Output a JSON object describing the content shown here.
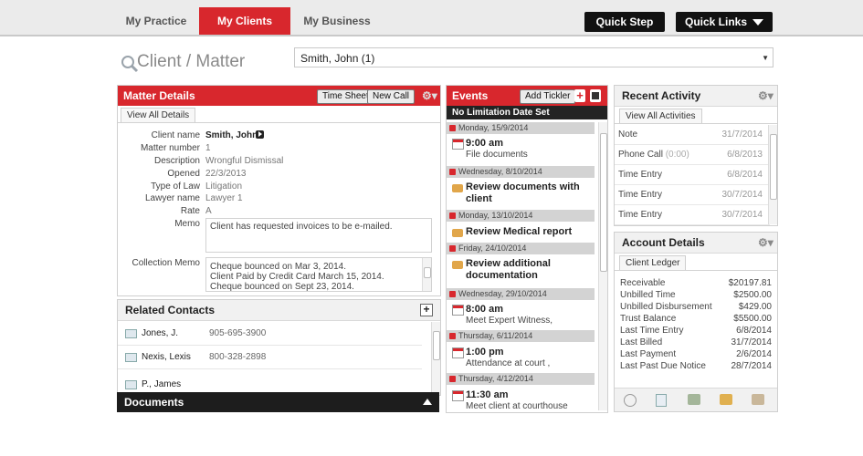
{
  "nav": {
    "tabs": [
      {
        "label": "My Practice"
      },
      {
        "label": "My Clients"
      },
      {
        "label": "My Business"
      }
    ],
    "quick_step": "Quick Step",
    "quick_links": "Quick Links",
    "accent": "#d8272d"
  },
  "search": {
    "title": "Client / Matter",
    "value": "Smith, John (1)"
  },
  "matter": {
    "header": "Matter Details",
    "time_sheet": "Time Sheet",
    "new_call": "New Call",
    "view_all": "View All Details",
    "fields": {
      "client_name_label": "Client name",
      "client_name": "Smith, John",
      "matter_number_label": "Matter number",
      "matter_number": "1",
      "description_label": "Description",
      "description": "Wrongful Dismissal",
      "opened_label": "Opened",
      "opened": "22/3/2013",
      "type_label": "Type of Law",
      "type": "Litigation",
      "lawyer_label": "Lawyer name",
      "lawyer": "Lawyer 1",
      "rate_label": "Rate",
      "rate": "A",
      "memo_label": "Memo",
      "memo": "Client has requested invoices to be e-mailed.",
      "collection_label": "Collection Memo",
      "collection_lines": [
        "Cheque bounced on Mar 3, 2014.",
        "Client Paid by Credit Card March 15, 2014.",
        "Cheque bounced  on Sept 23, 2014."
      ]
    }
  },
  "contacts": {
    "header": "Related Contacts",
    "items": [
      {
        "name": "Jones, J.",
        "phone": "905-695-3900"
      },
      {
        "name": "Nexis, Lexis",
        "phone": "800-328-2898"
      },
      {
        "name": "P., James",
        "phone": ""
      }
    ]
  },
  "documents": {
    "header": "Documents"
  },
  "events": {
    "header": "Events",
    "add_tickler": "Add Tickler",
    "no_limitation": "No Limitation Date Set",
    "dates": [
      "Monday, 15/9/2014",
      "Wednesday, 8/10/2014",
      "Monday, 13/10/2014",
      "Friday, 24/10/2014",
      "Wednesday, 29/10/2014",
      "Thursday, 6/11/2014",
      "Thursday, 4/12/2014"
    ],
    "items": [
      {
        "time": "9:00 am",
        "desc": "File documents"
      },
      {
        "title": "Review documents with client"
      },
      {
        "title": "Review Medical report"
      },
      {
        "title": "Review additional documentation"
      },
      {
        "time": "8:00 am",
        "desc": "Meet Expert Witness,"
      },
      {
        "time": "1:00 pm",
        "desc": "Attendance at court ,"
      },
      {
        "time": "11:30 am",
        "desc": "Meet client at courthouse"
      }
    ]
  },
  "recent": {
    "header": "Recent Activity",
    "view_all": "View All Activities",
    "items": [
      {
        "type": "Note",
        "date": "31/7/2014"
      },
      {
        "type": "Phone Call",
        "extra": "(0:00)",
        "date": "6/8/2013"
      },
      {
        "type": "Time Entry",
        "date": "6/8/2014"
      },
      {
        "type": "Time Entry",
        "date": "30/7/2014"
      },
      {
        "type": "Time Entry",
        "date": "30/7/2014"
      }
    ]
  },
  "account": {
    "header": "Account Details",
    "tab": "Client Ledger",
    "rows": [
      {
        "label": "Receivable",
        "value": "$20197.81"
      },
      {
        "label": "Unbilled Time",
        "value": "$2500.00"
      },
      {
        "label": "Unbilled Disbursement",
        "value": "$429.00"
      },
      {
        "label": "Trust Balance",
        "value": "$5500.00"
      },
      {
        "label": "Last Time Entry",
        "value": "6/8/2014"
      },
      {
        "label": "Last Billed",
        "value": "31/7/2014"
      },
      {
        "label": "Last Payment",
        "value": "2/6/2014"
      },
      {
        "label": "Last Past Due Notice",
        "value": "28/7/2014"
      }
    ]
  }
}
